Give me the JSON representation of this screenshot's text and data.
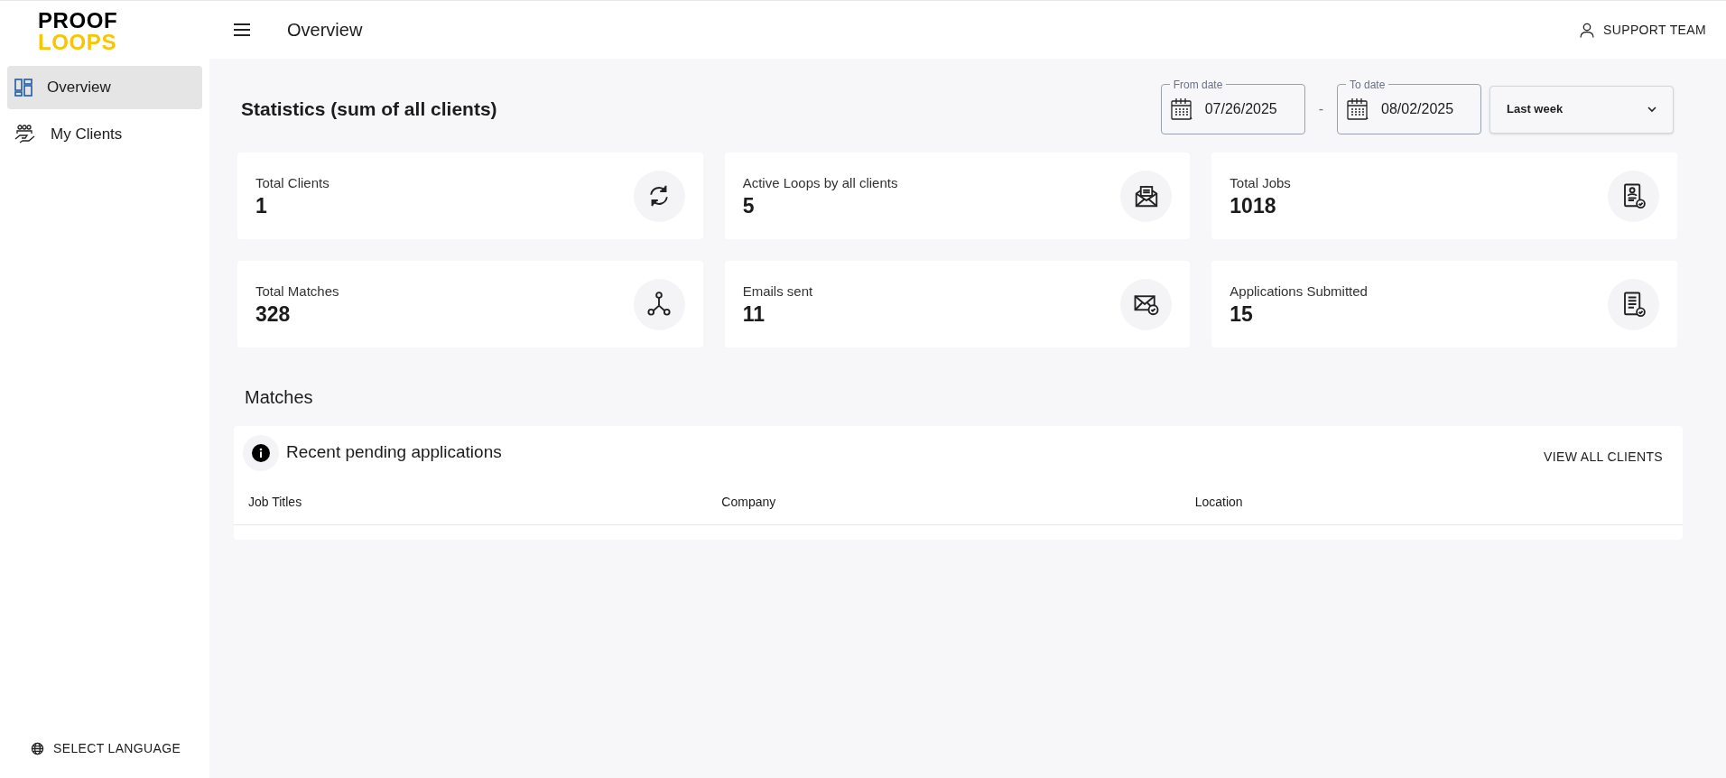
{
  "logo": {
    "line_1": "PROOF",
    "line_2": "LOOPS"
  },
  "sidebar": {
    "items": [
      {
        "label": "Overview",
        "kind": "dashboard",
        "selected": true
      },
      {
        "label": "My Clients",
        "kind": "clients",
        "selected": false
      }
    ],
    "language": "SELECT LANGUAGE"
  },
  "header": {
    "title": "Overview",
    "user": "SUPPORT TEAM"
  },
  "statistics": {
    "title": "Statistics (sum of all clients)",
    "from_date": {
      "label": "From date",
      "value": "07/26/2025"
    },
    "separator": "-",
    "to_date": {
      "label": "To date",
      "value": "08/02/2025"
    },
    "range": "Last week",
    "cards": [
      {
        "label": "Total Clients",
        "value": "1",
        "kind": "clients"
      },
      {
        "label": "Active Loops by all clients",
        "value": "5",
        "kind": "loops"
      },
      {
        "label": "Total Jobs",
        "value": "1018",
        "kind": "jobs"
      },
      {
        "label": "Total Matches",
        "value": "328",
        "kind": "matches"
      },
      {
        "label": "Emails sent",
        "value": "11",
        "kind": "emails"
      },
      {
        "label": "Applications Submitted",
        "value": "15",
        "kind": "applications"
      }
    ]
  },
  "matches": {
    "title": "Matches",
    "panel_title": "Recent pending applications",
    "action": "VIEW ALL CLIENTS",
    "table": {
      "columns": [
        "Job Titles",
        "Company",
        "Location"
      ]
    }
  }
}
